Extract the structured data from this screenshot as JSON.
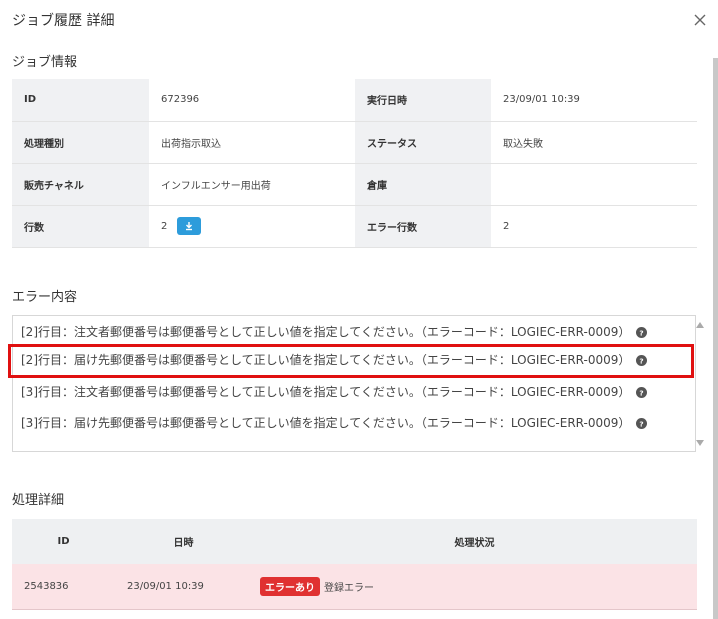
{
  "dialog": {
    "title": "ジョブ履歴 詳細"
  },
  "job_info": {
    "section_title": "ジョブ情報",
    "rows": [
      {
        "label1": "ID",
        "value1": "672396",
        "label2": "実行日時",
        "value2": "23/09/01 10:39"
      },
      {
        "label1": "処理種別",
        "value1": "出荷指示取込",
        "label2": "ステータス",
        "value2": "取込失敗"
      },
      {
        "label1": "販売チャネル",
        "value1": "インフルエンサー用出荷",
        "label2": "倉庫",
        "value2": ""
      },
      {
        "label1": "行数",
        "value1": "2",
        "label2": "エラー行数",
        "value2": "2"
      }
    ]
  },
  "error_content": {
    "section_title": "エラー内容",
    "lines": [
      "[2]行目：注文者郵便番号は郵便番号として正しい値を指定してください。（エラーコード：LOGIEC-ERR-0009）",
      "[2]行目：届け先郵便番号は郵便番号として正しい値を指定してください。（エラーコード：LOGIEC-ERR-0009）",
      "[3]行目：注文者郵便番号は郵便番号として正しい値を指定してください。（エラーコード：LOGIEC-ERR-0009）",
      "[3]行目：届け先郵便番号は郵便番号として正しい値を指定してください。（エラーコード：LOGIEC-ERR-0009）"
    ]
  },
  "process_detail": {
    "section_title": "処理詳細",
    "headers": {
      "id": "ID",
      "datetime": "日時",
      "status": "処理状況"
    },
    "rows": [
      {
        "id": "2543836",
        "datetime": "23/09/01 10:39",
        "badge": "エラーあり",
        "status_text": "登録エラー"
      }
    ]
  },
  "colors": {
    "accent": "#2d9cdb",
    "error_badge": "#e03131",
    "highlight": "#e01010",
    "error_row_bg": "#fbe3e6"
  },
  "icons": {
    "close": "close-icon",
    "download": "download-icon",
    "help": "help-icon"
  }
}
